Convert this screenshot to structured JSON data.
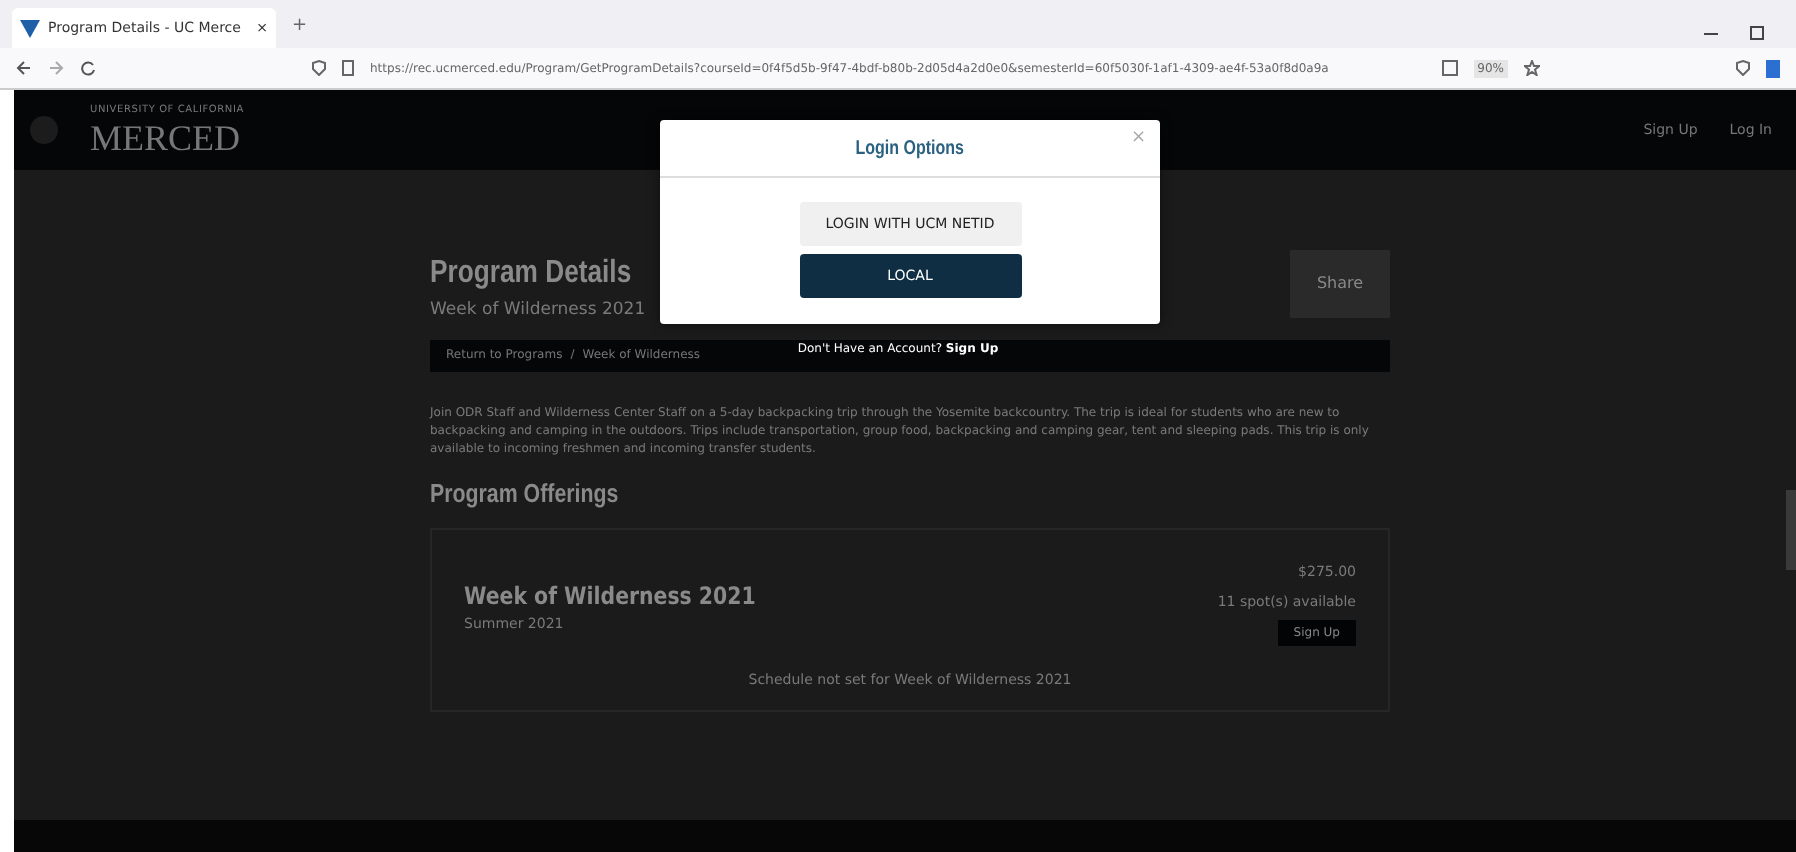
{
  "browser": {
    "tab_title": "Program Details - UC Merce",
    "tab_close": "×",
    "new_tab": "+",
    "url": "https://rec.ucmerced.edu/Program/GetProgramDetails?courseId=0f4f5d5b-9f47-4bdf-b80b-2d05d4a2d0e0&semesterId=60f5030f-1af1-4309-ae4f-53a0f8d0a9a",
    "zoom": "90%"
  },
  "header": {
    "logo_small": "UNIVERSITY OF CALIFORNIA",
    "logo_text": "MERCED",
    "nav": [
      "Sign Up",
      "Log In"
    ]
  },
  "page": {
    "title": "Program Details",
    "subtitle": "Week of Wilderness 2021",
    "share_button": "Share",
    "breadcrumb": [
      "Return to Programs",
      "Week of Wilderness"
    ],
    "breadcrumb_separator": "/",
    "description": "Join ODR Staff and Wilderness Center Staff on a 5-day backpacking trip through the Yosemite backcountry. The trip is ideal for students who are new to backpacking and camping in the outdoors. Trips include transportation, group food, backpacking and camping gear, tent and sleeping pads. This trip is only available to incoming freshmen and incoming transfer students.",
    "offerings_title": "Program Offerings",
    "offerings": [
      {
        "name": "Week of Wilderness 2021",
        "term": "Summer 2021",
        "price": "$275.00",
        "availability": "11 spot(s) available",
        "button": "Sign Up",
        "schedule_note": "Schedule not set for Week of Wilderness 2021"
      }
    ]
  },
  "modal": {
    "title": "Login Options",
    "close": "×",
    "buttons": [
      {
        "label": "LOGIN WITH UCM NETID",
        "kind": "secondary"
      },
      {
        "label": "LOCAL",
        "kind": "primary"
      }
    ],
    "footer": {
      "text": "Don't Have an Account?",
      "link": "Sign Up"
    }
  }
}
